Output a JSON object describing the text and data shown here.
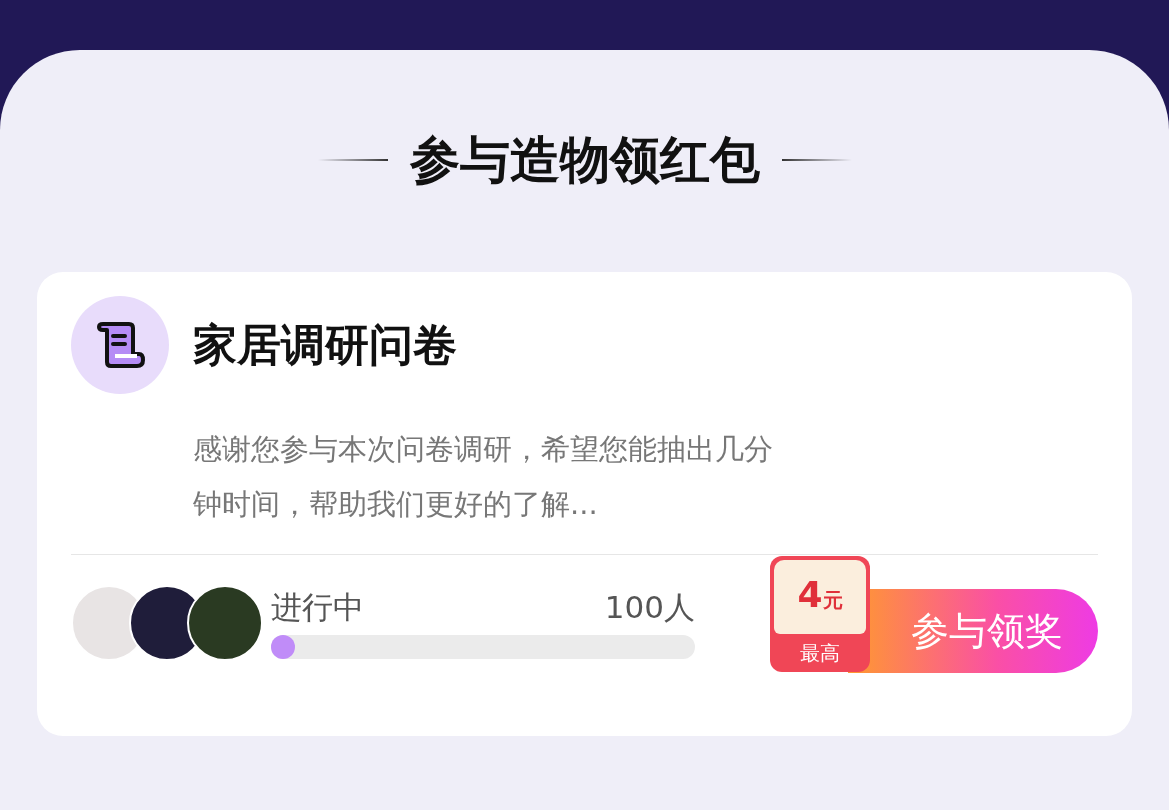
{
  "heading": "参与造物领红包",
  "card": {
    "title": "家居调研问卷",
    "description": "感谢您参与本次问卷调研，希望您能抽出几分钟时间，帮助我们更好的了解...",
    "avatars": [
      {
        "color": "#e8e4e4"
      },
      {
        "color": "#1f1d3a"
      },
      {
        "color": "#2a3a22"
      }
    ],
    "status": "进行中",
    "count": "100人",
    "progress": {
      "level": 0.04
    },
    "reward": {
      "amount": "4",
      "unit": "元",
      "note": "最高"
    },
    "button": "参与领奖"
  }
}
